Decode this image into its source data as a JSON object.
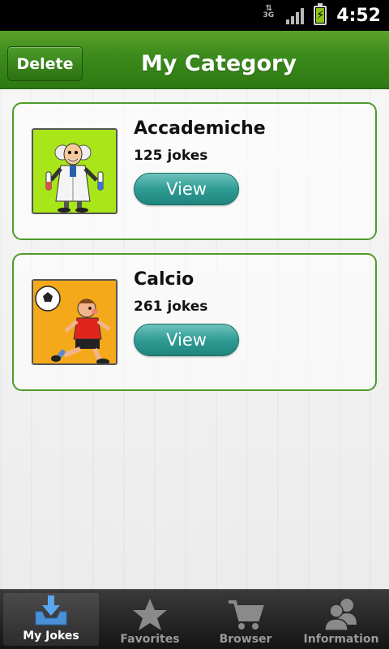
{
  "status_bar": {
    "network_type": "3G",
    "time": "4:52"
  },
  "header": {
    "delete_label": "Delete",
    "title": "My Category"
  },
  "categories": [
    {
      "title": "Accademiche",
      "count": "125 jokes",
      "view_label": "View",
      "image": "professor-illustration"
    },
    {
      "title": "Calcio",
      "count": "261 jokes",
      "view_label": "View",
      "image": "soccer-player-illustration"
    }
  ],
  "tabs": [
    {
      "label": "My Jokes",
      "icon": "inbox-download-icon",
      "active": true
    },
    {
      "label": "Favorites",
      "icon": "star-icon",
      "active": false
    },
    {
      "label": "Browser",
      "icon": "cart-icon",
      "active": false
    },
    {
      "label": "Information",
      "icon": "people-icon",
      "active": false
    }
  ],
  "colors": {
    "header_green": "#3b8a1c",
    "card_border": "#4e9b2b",
    "view_button": "#2f9c94",
    "tab_bar": "#1c1c1c"
  }
}
